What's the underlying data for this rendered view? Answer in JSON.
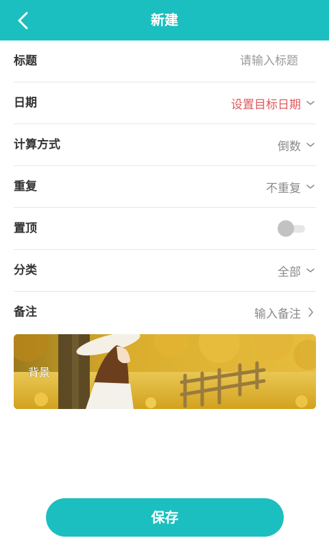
{
  "header": {
    "title": "新建",
    "back_icon": "chevron-left-icon",
    "color": "#1cbfbf"
  },
  "form": {
    "title": {
      "label": "标题",
      "placeholder": "请输入标题",
      "value": ""
    },
    "date": {
      "label": "日期",
      "value": "设置目标日期",
      "value_color": "#e0585b"
    },
    "calc_method": {
      "label": "计算方式",
      "value": "倒数"
    },
    "repeat": {
      "label": "重复",
      "value": "不重复"
    },
    "pin_top": {
      "label": "置顶",
      "enabled": false
    },
    "category": {
      "label": "分类",
      "value": "全部"
    },
    "note": {
      "label": "备注",
      "value": "输入备注"
    }
  },
  "background": {
    "label": "背景"
  },
  "save_button": {
    "label": "保存",
    "color": "#1cbfbf"
  }
}
